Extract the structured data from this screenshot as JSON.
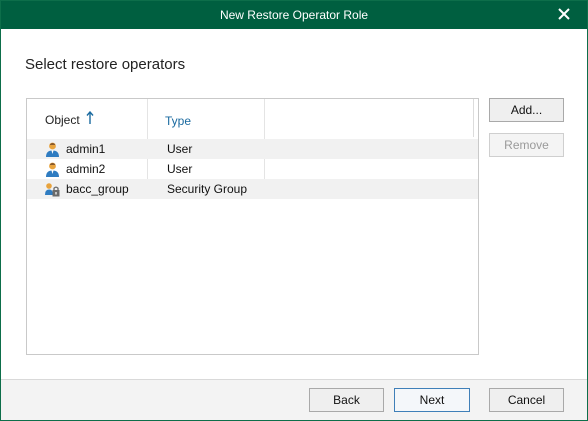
{
  "window": {
    "title": "New Restore Operator Role"
  },
  "heading": "Select restore operators",
  "table": {
    "columns": [
      "Object",
      "Type"
    ],
    "sort_column": "Object",
    "rows": [
      {
        "name": "admin1",
        "type": "User",
        "icon": "user-icon"
      },
      {
        "name": "admin2",
        "type": "User",
        "icon": "user-icon"
      },
      {
        "name": "bacc_group",
        "type": "Security Group",
        "icon": "group-lock-icon"
      }
    ]
  },
  "buttons": {
    "add": "Add...",
    "remove": "Remove",
    "back": "Back",
    "next": "Next",
    "cancel": "Cancel"
  },
  "colors": {
    "titlebar": "#005f40",
    "accent_blue": "#1a6aa0"
  }
}
